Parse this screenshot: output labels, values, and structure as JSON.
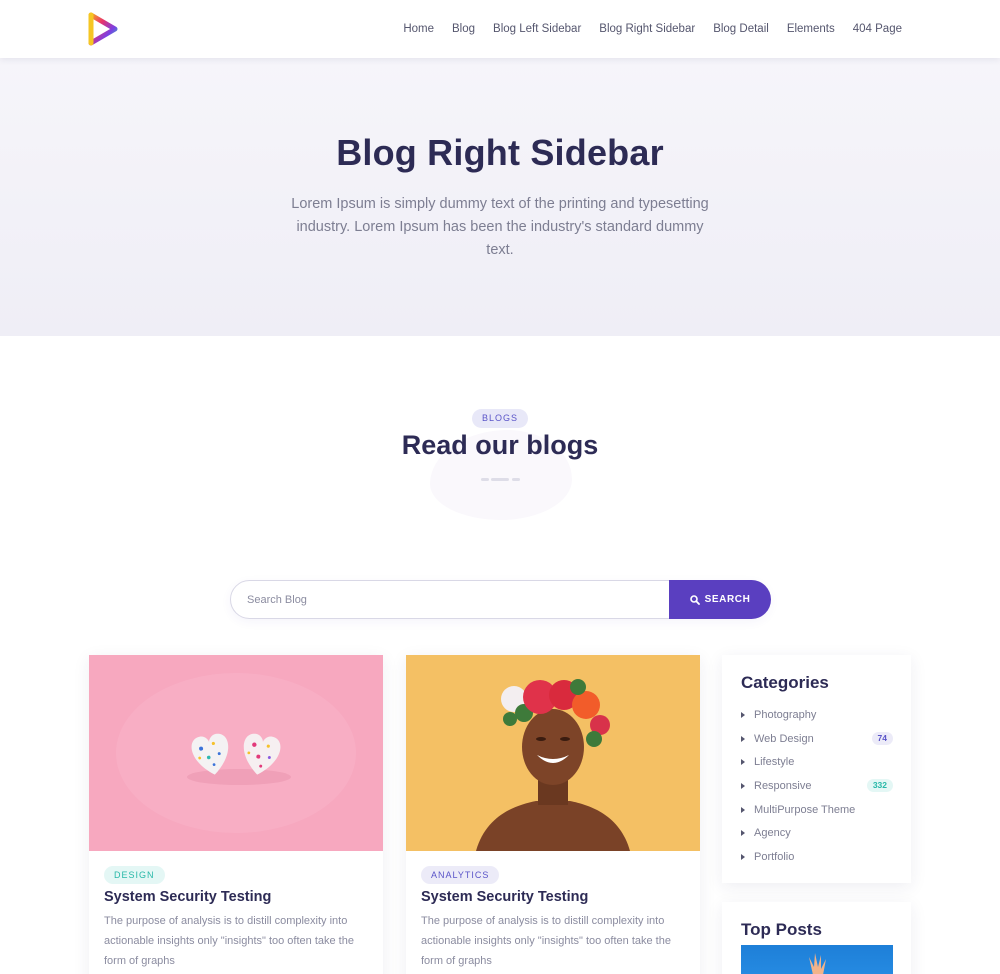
{
  "header": {
    "nav": [
      "Home",
      "Blog",
      "Blog Left Sidebar",
      "Blog Right Sidebar",
      "Blog Detail",
      "Elements",
      "404 Page"
    ]
  },
  "hero": {
    "title": "Blog Right Sidebar",
    "subtitle": "Lorem Ipsum is simply dummy text of the printing and typesetting industry. Lorem Ipsum has been the industry's standard dummy text."
  },
  "section": {
    "badge": "BLOGS",
    "title": "Read our blogs"
  },
  "search": {
    "placeholder": "Search Blog",
    "button_label": "SEARCH"
  },
  "posts": [
    {
      "tag": "DESIGN",
      "title": "System Security Testing",
      "excerpt": "The purpose of analysis is to distill complexity into actionable insights only \"insights\" too often take the form of graphs"
    },
    {
      "tag": "ANALYTICS",
      "title": "System Security Testing",
      "excerpt": "The purpose of analysis is to distill complexity into actionable insights only \"insights\" too often take the form of graphs"
    }
  ],
  "sidebar": {
    "categories_title": "Categories",
    "categories": [
      {
        "label": "Photography",
        "count": ""
      },
      {
        "label": "Web Design",
        "count": "74"
      },
      {
        "label": "Lifestyle",
        "count": ""
      },
      {
        "label": "Responsive",
        "count": "332"
      },
      {
        "label": "MultiPurpose Theme",
        "count": ""
      },
      {
        "label": "Agency",
        "count": ""
      },
      {
        "label": "Portfolio",
        "count": ""
      }
    ],
    "top_posts_title": "Top Posts"
  },
  "colors": {
    "accent": "#5a3fc0",
    "heading": "#2d2b55",
    "teal": "#27b8a8"
  }
}
